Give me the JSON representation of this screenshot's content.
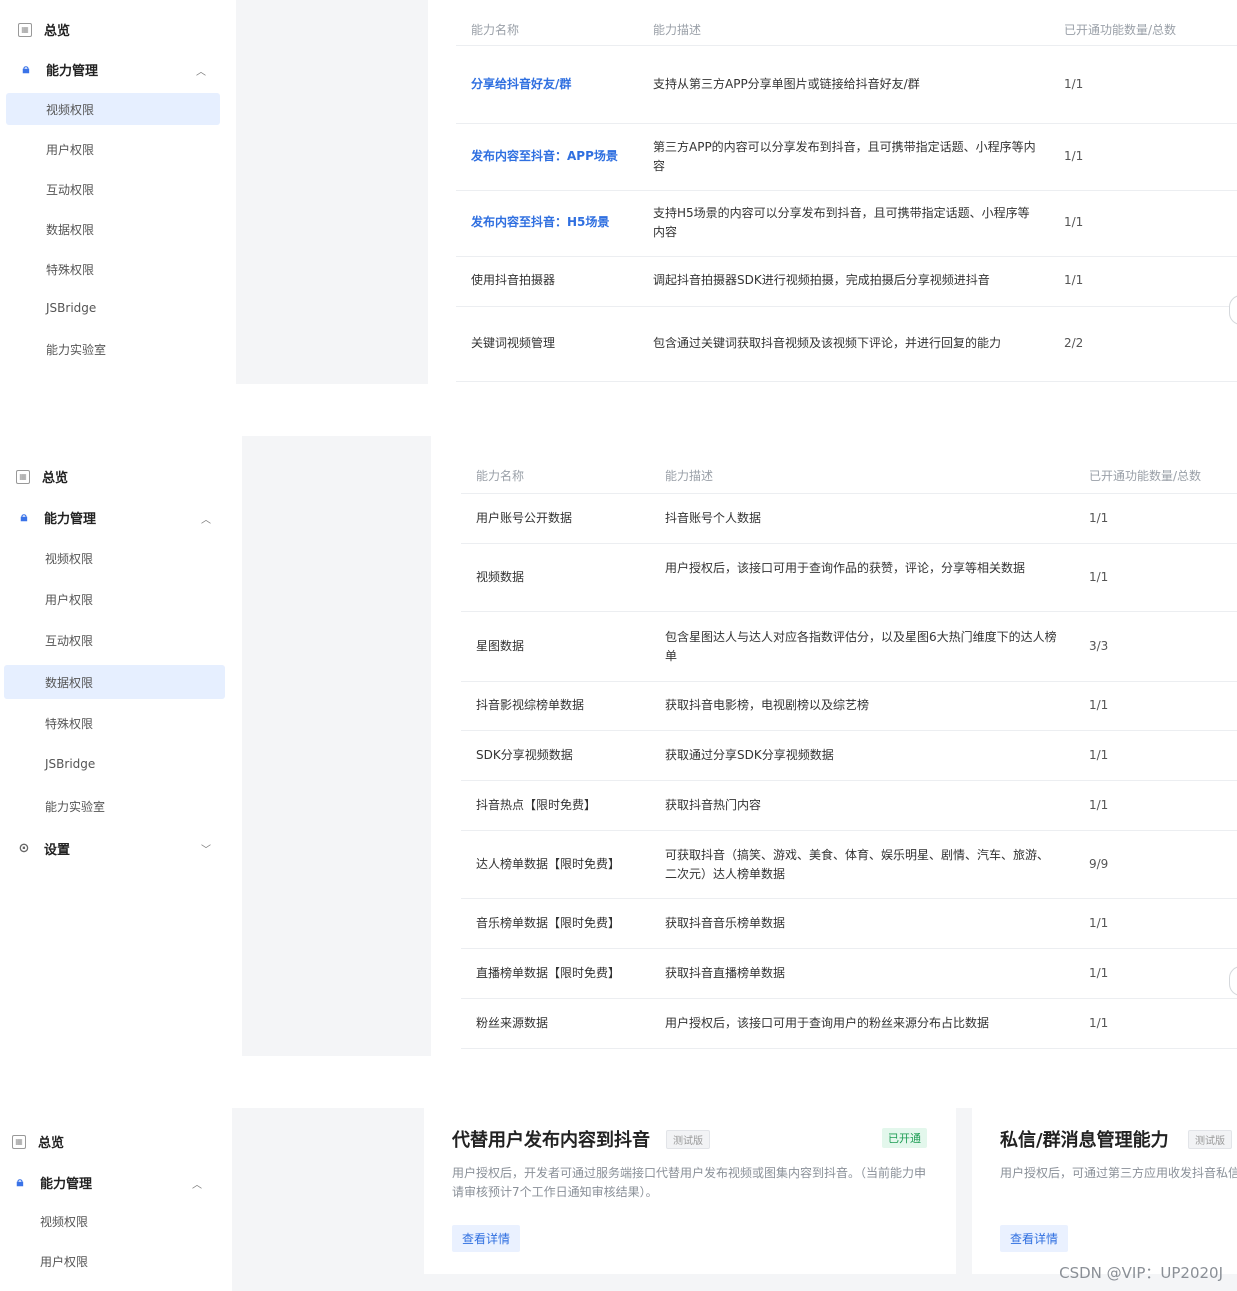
{
  "nav": {
    "overview": "总览",
    "ability_mgmt": "能力管理",
    "video": "视频权限",
    "user": "用户权限",
    "interact": "互动权限",
    "data": "数据权限",
    "special": "特殊权限",
    "jsbridge": "JSBridge",
    "lab": "能力实验室",
    "settings": "设置"
  },
  "table_headers": {
    "name": "能力名称",
    "desc": "能力描述",
    "count": "已开通功能数量/总数"
  },
  "table1": [
    {
      "name": "分享给抖音好友/群",
      "desc": "支持从第三方APP分享单图片或链接给抖音好友/群",
      "count": "1/1"
    },
    {
      "name": "发布内容至抖音：APP场景",
      "desc": "第三方APP的内容可以分享发布到抖音，且可携带指定话题、小程序等内容",
      "count": "1/1"
    },
    {
      "name": "发布内容至抖音：H5场景",
      "desc": "支持H5场景的内容可以分享发布到抖音，且可携带指定话题、小程序等内容",
      "count": "1/1"
    },
    {
      "name": "使用抖音拍摄器",
      "desc": "调起抖音拍摄器SDK进行视频拍摄，完成拍摄后分享视频进抖音",
      "count": "1/1"
    },
    {
      "name": "关键词视频管理",
      "desc": "包含通过关键词获取抖音视频及该视频下评论，并进行回复的能力",
      "count": "2/2"
    }
  ],
  "table2": [
    {
      "name": "用户账号公开数据",
      "desc": "抖音账号个人数据",
      "count": "1/1"
    },
    {
      "name": "视频数据",
      "desc": "用户授权后，该接口可用于查询作品的获赞，评论，分享等相关数据",
      "count": "1/1"
    },
    {
      "name": "星图数据",
      "desc": "包含星图达人与达人对应各指数评估分，以及星图6大热门维度下的达人榜单",
      "count": "3/3"
    },
    {
      "name": "抖音影视综榜单数据",
      "desc": "获取抖音电影榜，电视剧榜以及综艺榜",
      "count": "1/1"
    },
    {
      "name": "SDK分享视频数据",
      "desc": "获取通过分享SDK分享视频数据",
      "count": "1/1"
    },
    {
      "name": "抖音热点【限时免费】",
      "desc": "获取抖音热门内容",
      "count": "1/1"
    },
    {
      "name": "达人榜单数据【限时免费】",
      "desc": "可获取抖音（搞笑、游戏、美食、体育、娱乐明星、剧情、汽车、旅游、二次元）达人榜单数据",
      "count": "9/9"
    },
    {
      "name": "音乐榜单数据【限时免费】",
      "desc": "获取抖音音乐榜单数据",
      "count": "1/1"
    },
    {
      "name": "直播榜单数据【限时免费】",
      "desc": "获取抖音直播榜单数据",
      "count": "1/1"
    },
    {
      "name": "粉丝来源数据",
      "desc": "用户授权后，该接口可用于查询用户的粉丝来源分布占比数据",
      "count": "1/1"
    }
  ],
  "cards": [
    {
      "title": "代替用户发布内容到抖音",
      "tag": "测试版",
      "status": "已开通",
      "desc": "用户授权后，开发者可通过服务端接口代替用户发布视频或图集内容到抖音。（当前能力申请审核预计7个工作日通知审核结果）。",
      "button": "查看详情"
    },
    {
      "title": "私信/群消息管理能力",
      "tag": "测试版",
      "desc": "用户授权后，可通过第三方应用收发抖音私信类型，包括不限于文字、图片、视频、消息",
      "button": "查看详情"
    }
  ],
  "watermark": "CSDN @VIP：UP2020J",
  "colors": {
    "accent": "#2f6fe0",
    "active_bg": "#e6efff",
    "enabled_tag": "#1f9d55"
  }
}
